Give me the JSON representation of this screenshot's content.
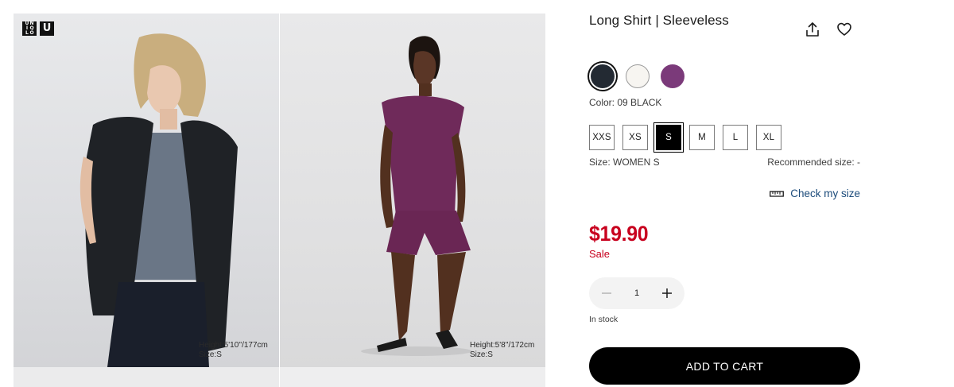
{
  "brand": {
    "logo_left": [
      "U",
      "N",
      "I",
      "Q",
      "L",
      "O"
    ],
    "logo_right": "U"
  },
  "gallery": {
    "photos": [
      {
        "caption_height": "Height:5'10''/177cm",
        "caption_size": "Size:S"
      },
      {
        "caption_height": "Height:5'8''/172cm",
        "caption_size": "Size:S"
      }
    ]
  },
  "product": {
    "title": "Long Shirt | Sleeveless",
    "colors": [
      {
        "name": "black",
        "hex": "#232a33",
        "selected": true
      },
      {
        "name": "off-white",
        "hex": "#f7f5f1",
        "selected": false
      },
      {
        "name": "purple",
        "hex": "#7b3a7a",
        "selected": false
      }
    ],
    "color_label": "Color: 09 BLACK",
    "sizes": [
      "XXS",
      "XS",
      "S",
      "M",
      "L",
      "XL"
    ],
    "selected_size": "S",
    "size_label": "Size: WOMEN S",
    "recommended_size": "Recommended size: -",
    "check_size_label": "Check my size",
    "price": "$19.90",
    "price_color": "#c8001e",
    "sale_label": "Sale",
    "quantity": "1",
    "stock_label": "In stock",
    "add_to_cart": "ADD TO CART"
  },
  "icons": {
    "share": "share-icon",
    "wishlist": "heart-icon",
    "ruler": "ruler-icon",
    "minus": "minus-icon",
    "plus": "plus-icon"
  }
}
